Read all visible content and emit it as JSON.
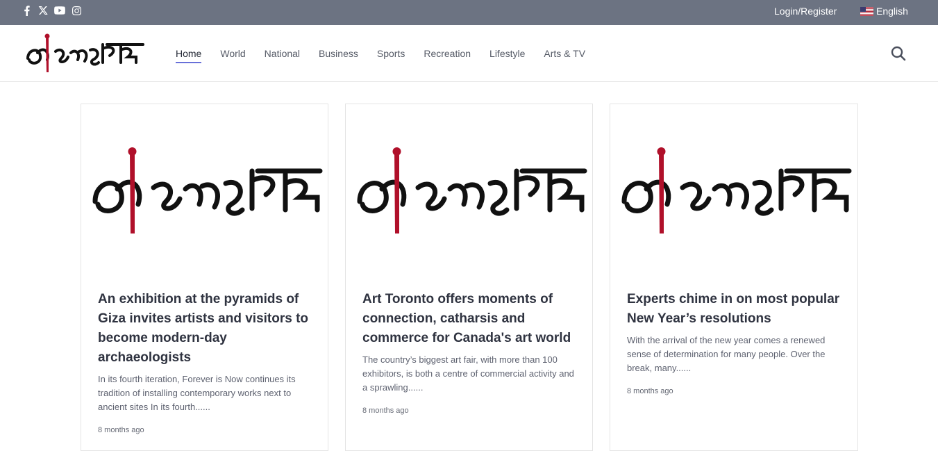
{
  "topbar": {
    "social_icons": [
      "facebook-icon",
      "x-twitter-icon",
      "youtube-icon",
      "instagram-icon"
    ],
    "login_label": "Login/Register",
    "language_label": "English"
  },
  "header": {
    "logo_alt": "আওয়াজ তোলো",
    "nav": [
      {
        "label": "Home",
        "active": true
      },
      {
        "label": "World"
      },
      {
        "label": "National"
      },
      {
        "label": "Business"
      },
      {
        "label": "Sports"
      },
      {
        "label": "Recreation"
      },
      {
        "label": "Lifestyle"
      },
      {
        "label": "Arts & TV"
      }
    ]
  },
  "articles": [
    {
      "title": "An exhibition at the pyramids of Giza invites artists and visitors to become modern-day archaeologists",
      "excerpt": "In its fourth iteration, Forever is Now continues its tradition of installing contemporary works next to ancient sites In its fourth......",
      "time": "8 months ago"
    },
    {
      "title": "Art Toronto offers moments of connection, catharsis and commerce for Canada's art world",
      "excerpt": "The country’s biggest art fair, with more than 100 exhibitors, is both a centre of commercial activity and a sprawling......",
      "time": "8 months ago"
    },
    {
      "title": "Experts chime in on most popular New Year’s resolutions",
      "excerpt": "With the arrival of the new year comes a renewed sense of determination for many people. Over the break, many......",
      "time": "8 months ago"
    }
  ],
  "colors": {
    "topbar": "#6c7382",
    "accent": "#6870d9",
    "logo_red": "#b0102a"
  }
}
